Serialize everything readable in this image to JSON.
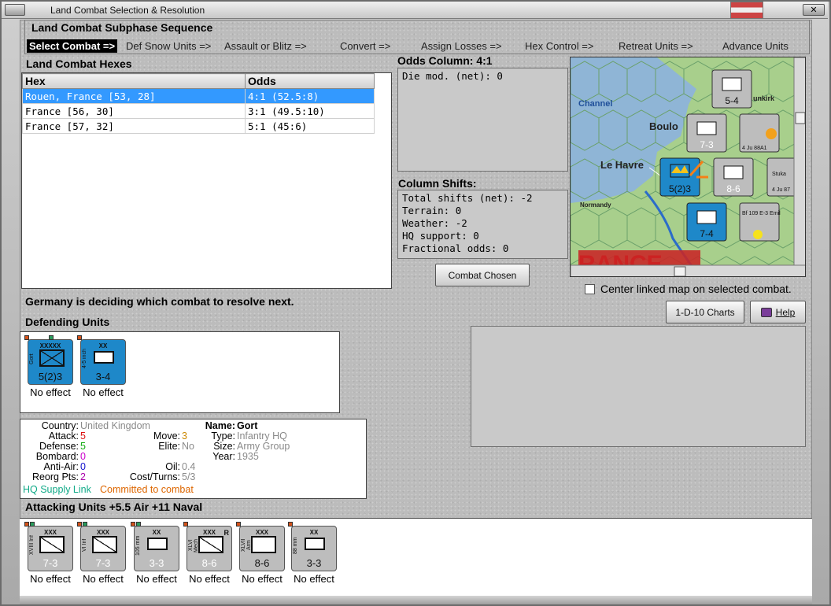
{
  "window": {
    "title": "Land Combat Selection & Resolution"
  },
  "sequence": {
    "title": "Land Combat Subphase Sequence",
    "steps": [
      "Select Combat =>",
      "Def Snow Units =>",
      "Assault or Blitz =>",
      "Convert =>",
      "Assign Losses =>",
      "Hex Control =>",
      "Retreat Units =>",
      "Advance Units"
    ],
    "active_index": 0
  },
  "hexes": {
    "title": "Land Combat Hexes",
    "columns": [
      "Hex",
      "Odds"
    ],
    "rows": [
      {
        "hex": "Rouen, France [53, 28]",
        "odds": "4:1 (52.5:8)",
        "selected": true
      },
      {
        "hex": "France [56, 30]",
        "odds": "3:1 (49.5:10)",
        "selected": false
      },
      {
        "hex": "France [57, 32]",
        "odds": "5:1 (45:6)",
        "selected": false
      }
    ]
  },
  "odds": {
    "title": "Odds Column: 4:1",
    "lines": [
      "Die mod. (net): 0"
    ]
  },
  "shifts": {
    "title": "Column Shifts:",
    "lines": [
      "Total shifts (net): -2",
      "Terrain: 0",
      "Weather: -2",
      "HQ support: 0",
      "Fractional odds: 0"
    ]
  },
  "buttons": {
    "combat_chosen": "Combat Chosen",
    "charts": "1-D-10 Charts",
    "help": "Help"
  },
  "map": {
    "labels": [
      "Channel",
      "Boulo",
      "Le Havre",
      "Normandy",
      "unkirk",
      "RANCE"
    ],
    "counters": [
      {
        "strength": "5-4",
        "size": "XXX"
      },
      {
        "strength": "7-3",
        "size": "XXX"
      },
      {
        "strength": "5(2)3",
        "size": "XXXXX"
      },
      {
        "strength": "8-6",
        "size": "XXX"
      },
      {
        "strength": "7-4",
        "size": "XX"
      },
      {
        "air": "4 Ju 88A1"
      },
      {
        "air": "Stuka"
      },
      {
        "air": "4 Ju 87"
      },
      {
        "air": "Bf 109 E-3 Emil"
      }
    ]
  },
  "center_linked_label": "Center linked map on selected combat.",
  "status": "Germany is deciding which combat to resolve next.",
  "defending": {
    "title": "Defending Units",
    "units": [
      {
        "name": "Gort",
        "size": "XXXXX",
        "strength": "5(2)3",
        "effect": "No effect"
      },
      {
        "name": "4-5 inch",
        "size": "XX",
        "strength": "3-4",
        "effect": "No effect"
      }
    ]
  },
  "unit_info": {
    "country_label": "Country:",
    "country": "United Kingdom",
    "attack_label": "Attack:",
    "attack": "5",
    "defense_label": "Defense:",
    "defense": "5",
    "bombard_label": "Bombard:",
    "bombard": "0",
    "antiair_label": "Anti-Air:",
    "antiair": "0",
    "reorg_label": "Reorg Pts:",
    "reorg": "2",
    "move_label": "Move:",
    "move": "3",
    "elite_label": "Elite:",
    "elite": "No",
    "oil_label": "Oil:",
    "oil": "0.4",
    "cost_label": "Cost/Turns:",
    "cost": "5/3",
    "name_label": "Name:",
    "name": "Gort",
    "type_label": "Type:",
    "type": "Infantry HQ",
    "size_label": "Size:",
    "size": "Army Group",
    "year_label": "Year:",
    "year": "1935",
    "supply": "HQ Supply Link",
    "committed": "Committed to combat",
    "colors": {
      "attack": "#d11",
      "defense": "#1a1",
      "bombard": "#c0c",
      "antiair": "#11c",
      "reorg": "#a0a",
      "move": "#c80",
      "supply": "#1a8",
      "committed": "#d60"
    }
  },
  "attacking": {
    "title": "Attacking Units +5.5 Air +11 Naval",
    "units": [
      {
        "name": "XVIII Inf",
        "size": "XXX",
        "strength": "7-3",
        "effect": "No effect"
      },
      {
        "name": "VI Inf",
        "size": "XXX",
        "strength": "7-3",
        "effect": "No effect"
      },
      {
        "name": "105 mm",
        "size": "XX",
        "strength": "3-3",
        "effect": "No effect"
      },
      {
        "name": "XLVI Mech",
        "size": "XXX",
        "strength": "8-6",
        "effect": "No effect"
      },
      {
        "name": "XLVII Arm",
        "size": "XXX",
        "strength": "8-6",
        "effect": "No effect"
      },
      {
        "name": "88 mm",
        "size": "XX",
        "strength": "3-3",
        "effect": "No effect"
      }
    ]
  }
}
